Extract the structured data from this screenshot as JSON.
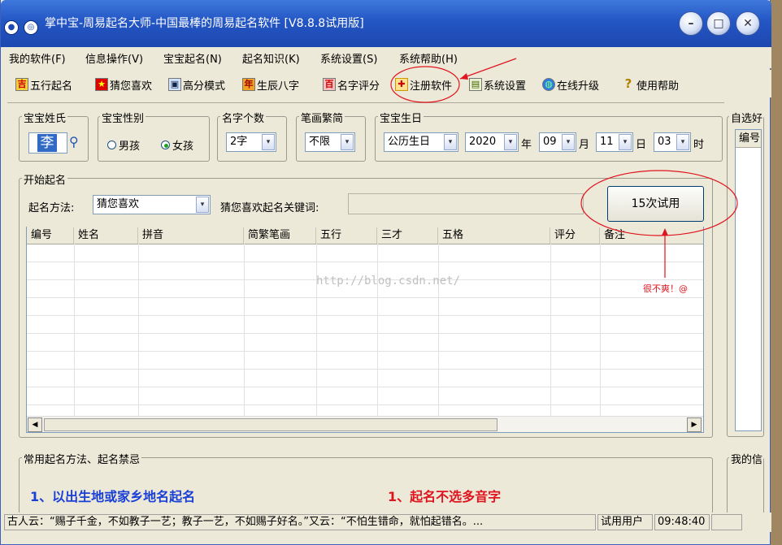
{
  "window": {
    "title": "掌中宝-周易起名大师-中国最棒的周易起名软件 [V8.8.8试用版]"
  },
  "menu": [
    "我的软件(F)",
    "信息操作(V)",
    "宝宝起名(N)",
    "起名知识(K)",
    "系统设置(S)",
    "系统帮助(H)"
  ],
  "toolbar": [
    {
      "label": "五行起名",
      "icon": "five-elements-icon"
    },
    {
      "label": "猜您喜欢",
      "icon": "star-icon"
    },
    {
      "label": "高分模式",
      "icon": "monitor-icon"
    },
    {
      "label": "生辰八字",
      "icon": "calendar-icon"
    },
    {
      "label": "名字评分",
      "icon": "score-icon"
    },
    {
      "label": "注册软件",
      "icon": "gift-icon"
    },
    {
      "label": "系统设置",
      "icon": "settings-icon"
    },
    {
      "label": "在线升级",
      "icon": "globe-icon"
    },
    {
      "label": "使用帮助",
      "icon": "help-icon"
    }
  ],
  "surname": {
    "legend": "宝宝姓氏",
    "value": "李"
  },
  "gender": {
    "legend": "宝宝性别",
    "male": "男孩",
    "female": "女孩",
    "selected": "女孩"
  },
  "name_count": {
    "legend": "名字个数",
    "value": "2字"
  },
  "stroke": {
    "legend": "笔画繁简",
    "value": "不限"
  },
  "birthday": {
    "legend": "宝宝生日",
    "calendar": "公历生日",
    "year": "2020",
    "year_unit": "年",
    "month": "09",
    "month_unit": "月",
    "day": "11",
    "day_unit": "日",
    "hour": "03",
    "hour_unit": "时"
  },
  "start": {
    "legend": "开始起名",
    "method_label": "起名方法:",
    "method_value": "猜您喜欢",
    "keyword_label": "猜您喜欢起名关键词:",
    "keyword_value": "",
    "trial_button": "15次试用"
  },
  "table": {
    "columns": [
      "编号",
      "姓名",
      "拼音",
      "简繁笔画",
      "五行",
      "三才",
      "五格",
      "评分",
      "备注"
    ]
  },
  "watermark": "http://blog.csdn.net/",
  "annotation": "很不爽！@",
  "right_panel": {
    "legend": "自选好",
    "column": "编号"
  },
  "bottom": {
    "legend": "常用起名方法、起名禁忌",
    "tip_left": "1、以出生地或家乡地名起名",
    "tip_right": "1、起名不选多音字",
    "right_legend": "我的信"
  },
  "status": {
    "quote": "古人云：“赐子千金，不如教子一艺；教子一艺，不如赐子好名。”又云：“不怕生错命，就怕起错名。...",
    "user": "试用用户",
    "time": "09:48:40"
  },
  "colors": {
    "title_bar": "#2356c4",
    "annotation_red": "#e0141e",
    "tip_blue": "#1a3fd6",
    "tip_red": "#e0141e"
  }
}
